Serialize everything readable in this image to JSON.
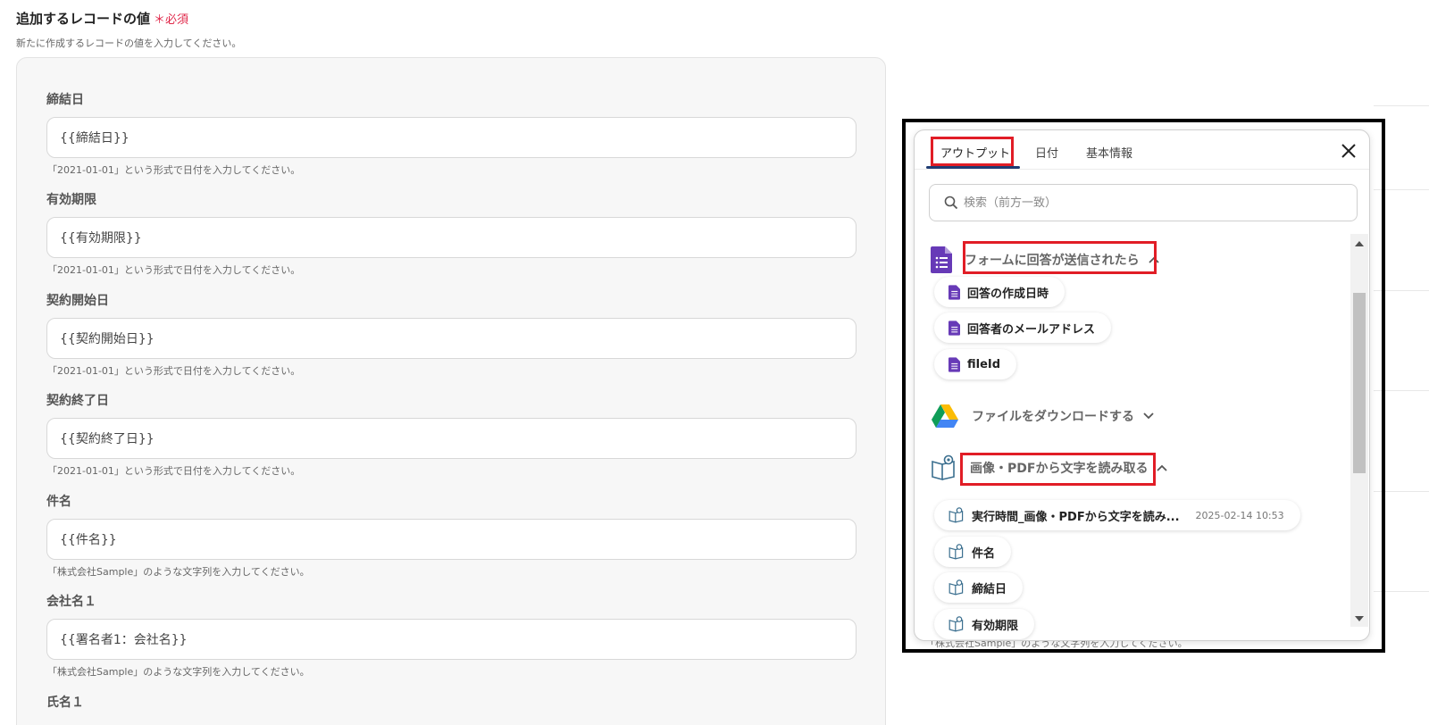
{
  "section": {
    "title": "追加するレコードの値",
    "required_label": "＊必須",
    "description": "新たに作成するレコードの値を入力してください。"
  },
  "fields": [
    {
      "label": "締結日",
      "value": "{{締結日}}",
      "hint": "「2021-01-01」という形式で日付を入力してください。"
    },
    {
      "label": "有効期限",
      "value": "{{有効期限}}",
      "hint": "「2021-01-01」という形式で日付を入力してください。"
    },
    {
      "label": "契約開始日",
      "value": "{{契約開始日}}",
      "hint": "「2021-01-01」という形式で日付を入力してください。"
    },
    {
      "label": "契約終了日",
      "value": "{{契約終了日}}",
      "hint": "「2021-01-01」という形式で日付を入力してください。"
    },
    {
      "label": "件名",
      "value": "{{件名}}",
      "hint": "「株式会社Sample」のような文字列を入力してください。"
    },
    {
      "label": "会社名１",
      "value": "{{署名者1：会社名}}",
      "hint": "「株式会社Sample」のような文字列を入力してください。"
    },
    {
      "label": "氏名１"
    }
  ],
  "background_hint": "「株式会社Sample」のような文字列を入力してください。",
  "popup": {
    "tabs": [
      "アウトプット",
      "日付",
      "基本情報"
    ],
    "active_tab": "アウトプット",
    "search_placeholder": "検索（前方一致）",
    "groups": [
      {
        "title": "フォームに回答が送信されたら",
        "icon": "google-forms-icon",
        "expanded": true,
        "items": [
          {
            "label": "回答の作成日時"
          },
          {
            "label": "回答者のメールアドレス"
          },
          {
            "label": "fileId"
          }
        ]
      },
      {
        "title": "ファイルをダウンロードする",
        "icon": "google-drive-icon",
        "expanded": false,
        "items": []
      },
      {
        "title": "画像・PDFから文字を読み取る",
        "icon": "ocr-book-icon",
        "expanded": true,
        "items": [
          {
            "label": "実行時間_画像・PDFから文字を読み...",
            "value": "2025-02-14 10:53"
          },
          {
            "label": "件名"
          },
          {
            "label": "締結日"
          },
          {
            "label": "有効期限"
          }
        ]
      }
    ]
  },
  "colors": {
    "accent_red": "#e11d26",
    "required_red": "#e0284a",
    "tab_underline": "#1f3c73",
    "forms_purple": "#673ab7"
  }
}
